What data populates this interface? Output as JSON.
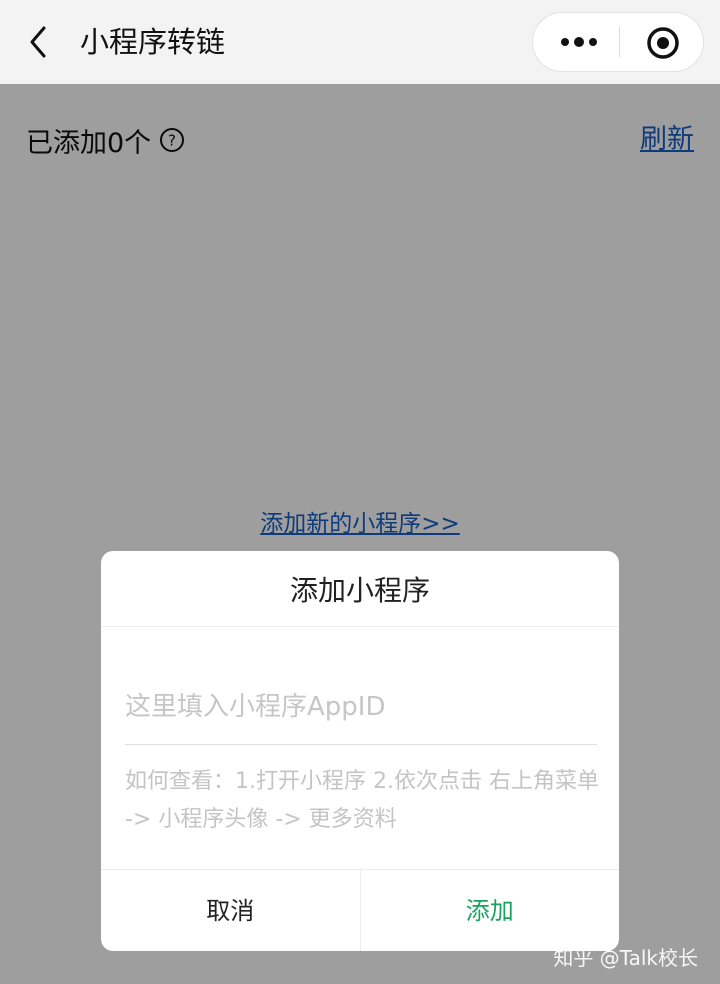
{
  "header": {
    "title": "小程序转链"
  },
  "page": {
    "count_label": "已添加0个",
    "refresh_label": "刷新",
    "add_new_label": "添加新的小程序>>"
  },
  "dialog": {
    "title": "添加小程序",
    "input_placeholder": "这里填入小程序AppID",
    "input_value": "",
    "hint": "如何查看：1.打开小程序 2.依次点击 右上角菜单 -> 小程序头像 -> 更多资料",
    "cancel_label": "取消",
    "confirm_label": "添加"
  },
  "watermark": "知乎 @Talk校长",
  "icons": {
    "back": "chevron-left-icon",
    "more": "more-dots-icon",
    "close": "target-circle-icon",
    "help": "question-circle-icon"
  },
  "colors": {
    "link": "#1a5fc7",
    "confirm": "#1aa260"
  }
}
